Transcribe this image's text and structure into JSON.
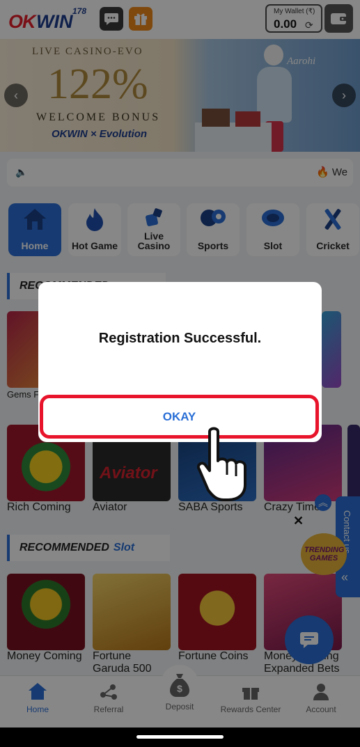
{
  "header": {
    "logo_ok": "OK",
    "logo_win": "WIN",
    "logo_num": "178",
    "wallet_label": "My Wallet (₹)",
    "wallet_amount": "0.00"
  },
  "banner": {
    "line1": "LIVE CASINO-EVO",
    "line2": "122%",
    "line3": "WELCOME BONUS",
    "brand": "OKWIN × Evolution",
    "signature": "Aarohi"
  },
  "marquee": {
    "text": "🔥 We"
  },
  "nav": [
    {
      "label": "Home"
    },
    {
      "label": "Hot Game"
    },
    {
      "label": "Live Casino"
    },
    {
      "label": "Sports"
    },
    {
      "label": "Slot"
    },
    {
      "label": "Cricket"
    }
  ],
  "sections": {
    "recommended_first": "RECOMMENDED",
    "recommended_live": "RECOMMENDED",
    "slot_word": "Slot"
  },
  "row1_cards": [
    {
      "name": "Gems F"
    }
  ],
  "row2_cards": [
    {
      "name": "Rich Coming"
    },
    {
      "name": "Aviator"
    },
    {
      "name": "SABA Sports"
    },
    {
      "name": "Crazy Time"
    }
  ],
  "slot_cards": [
    {
      "name": "Money Coming"
    },
    {
      "name": "Fortune Garuda 500"
    },
    {
      "name": "Fortune Coins"
    },
    {
      "name": "Money Coming Expanded Bets"
    }
  ],
  "footer": [
    {
      "label": "Home"
    },
    {
      "label": "Referral"
    },
    {
      "label": "Deposit"
    },
    {
      "label": "Rewards Center"
    },
    {
      "label": "Account"
    }
  ],
  "side_widget": {
    "text": "Contact us",
    "trending": "TRENDING GAMES"
  },
  "dialog": {
    "message": "Registration Successful.",
    "button": "OKAY"
  },
  "colors": {
    "accent": "#2a6fd6",
    "highlight": "#e8142b",
    "gift": "#f08a1c"
  }
}
